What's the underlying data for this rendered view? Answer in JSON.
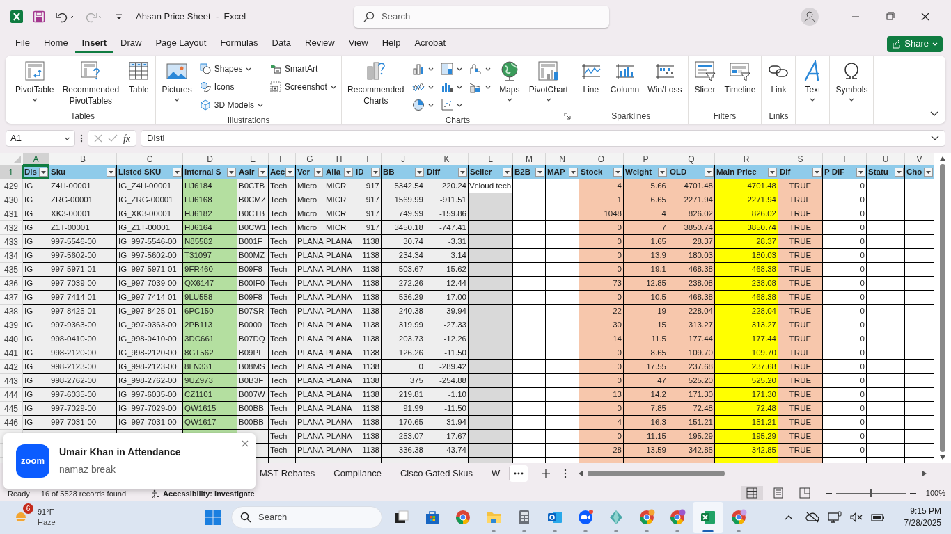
{
  "title_bar": {
    "title": "Ahsan Price Sheet  -  Excel",
    "search_placeholder": "Search"
  },
  "menu_tabs": [
    {
      "label": "File",
      "selected": false
    },
    {
      "label": "Home",
      "selected": false
    },
    {
      "label": "Insert",
      "selected": true
    },
    {
      "label": "Draw",
      "selected": false
    },
    {
      "label": "Page Layout",
      "selected": false
    },
    {
      "label": "Formulas",
      "selected": false
    },
    {
      "label": "Data",
      "selected": false
    },
    {
      "label": "Review",
      "selected": false
    },
    {
      "label": "View",
      "selected": false
    },
    {
      "label": "Help",
      "selected": false
    },
    {
      "label": "Acrobat",
      "selected": false
    }
  ],
  "share_button": "Share",
  "ribbon": {
    "groups": [
      {
        "label": "Tables",
        "items": [
          {
            "kind": "large",
            "label": "PivotTable",
            "dropdown": true
          },
          {
            "kind": "large",
            "label": "Recommended PivotTables",
            "dropdown": false
          },
          {
            "kind": "large",
            "label": "Table",
            "dropdown": false
          }
        ]
      },
      {
        "label": "Illustrations",
        "items": [
          {
            "kind": "large",
            "label": "Pictures",
            "dropdown": true
          },
          {
            "kind": "small",
            "label": "Shapes",
            "dropdown": true
          },
          {
            "kind": "small",
            "label": "Icons",
            "dropdown": false
          },
          {
            "kind": "small",
            "label": "3D Models",
            "dropdown": true
          },
          {
            "kind": "small",
            "label": "SmartArt",
            "dropdown": false
          },
          {
            "kind": "small",
            "label": "Screenshot",
            "dropdown": true
          }
        ]
      },
      {
        "label": "Charts",
        "launcher": true,
        "items": [
          {
            "kind": "large",
            "label": "Recommended Charts",
            "dropdown": false
          },
          {
            "kind": "icon",
            "dropdown": true
          },
          {
            "kind": "icon",
            "dropdown": true
          },
          {
            "kind": "icon",
            "dropdown": true
          },
          {
            "kind": "icon",
            "dropdown": true
          },
          {
            "kind": "icon",
            "dropdown": true
          },
          {
            "kind": "icon",
            "dropdown": true
          },
          {
            "kind": "icon",
            "dropdown": true
          },
          {
            "kind": "icon",
            "dropdown": true
          },
          {
            "kind": "large",
            "label": "Maps",
            "dropdown": true
          },
          {
            "kind": "large",
            "label": "PivotChart",
            "dropdown": true
          }
        ]
      },
      {
        "label": "Sparklines",
        "items": [
          {
            "kind": "large",
            "label": "Line",
            "dropdown": false
          },
          {
            "kind": "large",
            "label": "Column",
            "dropdown": false
          },
          {
            "kind": "large",
            "label": "Win/Loss",
            "dropdown": false
          }
        ]
      },
      {
        "label": "Filters",
        "items": [
          {
            "kind": "large",
            "label": "Slicer",
            "dropdown": false
          },
          {
            "kind": "large",
            "label": "Timeline",
            "dropdown": false
          }
        ]
      },
      {
        "label": "Links",
        "items": [
          {
            "kind": "large",
            "label": "Link",
            "dropdown": false
          }
        ]
      },
      {
        "items": [
          {
            "kind": "large",
            "label": "Text",
            "dropdown": true
          }
        ]
      },
      {
        "items": [
          {
            "kind": "large",
            "label": "Symbols",
            "dropdown": true
          }
        ]
      }
    ]
  },
  "formula_bar": {
    "name_box": "A1",
    "function_label": "fx",
    "formula": "Disti"
  },
  "sheet": {
    "header_row_number": "1",
    "columns": [
      {
        "letter": "A",
        "title": "Dis",
        "selected": true
      },
      {
        "letter": "B",
        "title": "Sku",
        "selected": false
      },
      {
        "letter": "C",
        "title": "Listed SKU",
        "selected": false
      },
      {
        "letter": "D",
        "title": "Internal S",
        "selected": false
      },
      {
        "letter": "E",
        "title": "Asir",
        "selected": false
      },
      {
        "letter": "F",
        "title": "Acc",
        "selected": false
      },
      {
        "letter": "G",
        "title": "Ver",
        "selected": false
      },
      {
        "letter": "H",
        "title": "Alia",
        "selected": false
      },
      {
        "letter": "I",
        "title": "ID",
        "selected": false
      },
      {
        "letter": "J",
        "title": "BB",
        "selected": false
      },
      {
        "letter": "K",
        "title": "Diff",
        "selected": false
      },
      {
        "letter": "L",
        "title": "Seller",
        "selected": false
      },
      {
        "letter": "M",
        "title": "B2B",
        "selected": false
      },
      {
        "letter": "N",
        "title": "MAP",
        "selected": false
      },
      {
        "letter": "O",
        "title": "Stock",
        "selected": false
      },
      {
        "letter": "P",
        "title": "Weight",
        "selected": false
      },
      {
        "letter": "Q",
        "title": "OLD",
        "selected": false
      },
      {
        "letter": "R",
        "title": "Main Price",
        "selected": false
      },
      {
        "letter": "S",
        "title": "Dif",
        "selected": false
      },
      {
        "letter": "T",
        "title": "P DIF",
        "selected": false
      },
      {
        "letter": "U",
        "title": "Statu",
        "selected": false
      },
      {
        "letter": "V",
        "title": "Cho",
        "selected": false
      }
    ],
    "rows": [
      {
        "number": "429",
        "cells": [
          "IG",
          "Z4H-00001",
          "IG_Z4H-00001",
          "HJ6184",
          "B0CTB",
          "Tech",
          "Micro",
          "MICR",
          "917",
          "5342.54",
          "220.24",
          "Vcloud tech",
          null,
          null,
          "4",
          "5.66",
          "4701.48",
          "4701.48",
          "TRUE",
          "0",
          null,
          null
        ]
      },
      {
        "number": "430",
        "cells": [
          "IG",
          "ZRG-00001",
          "IG_ZRG-00001",
          "HJ6168",
          "B0CMZ",
          "Tech",
          "Micro",
          "MICR",
          "917",
          "1569.99",
          "-911.51",
          null,
          null,
          null,
          "1",
          "6.65",
          "2271.94",
          "2271.94",
          "TRUE",
          "0",
          null,
          null
        ]
      },
      {
        "number": "431",
        "cells": [
          "IG",
          "XK3-00001",
          "IG_XK3-00001",
          "HJ6182",
          "B0CTB",
          "Tech",
          "Micro",
          "MICR",
          "917",
          "749.99",
          "-159.86",
          null,
          null,
          null,
          "1048",
          "4",
          "826.02",
          "826.02",
          "TRUE",
          "0",
          null,
          null
        ]
      },
      {
        "number": "432",
        "cells": [
          "IG",
          "Z1T-00001",
          "IG_Z1T-00001",
          "HJ6164",
          "B0CW1",
          "Tech",
          "Micro",
          "MICR",
          "917",
          "3450.18",
          "-747.41",
          null,
          null,
          null,
          "0",
          "7",
          "3850.74",
          "3850.74",
          "TRUE",
          "0",
          null,
          null
        ]
      },
      {
        "number": "433",
        "cells": [
          "IG",
          "997-5546-00",
          "IG_997-5546-00",
          "N85582",
          "B001F",
          "Tech",
          "PLANA",
          "PLANA",
          "1138",
          "30.74",
          "-3.31",
          null,
          null,
          null,
          "0",
          "1.65",
          "28.37",
          "28.37",
          "TRUE",
          "0",
          null,
          null
        ]
      },
      {
        "number": "434",
        "cells": [
          "IG",
          "997-5602-00",
          "IG_997-5602-00",
          "T31097",
          "B00MZ",
          "Tech",
          "PLANA",
          "PLANA",
          "1138",
          "234.34",
          "3.14",
          null,
          null,
          null,
          "0",
          "13.9",
          "180.03",
          "180.03",
          "TRUE",
          "0",
          null,
          null
        ]
      },
      {
        "number": "435",
        "cells": [
          "IG",
          "997-5971-01",
          "IG_997-5971-01",
          "9FR460",
          "B09F8",
          "Tech",
          "PLANA",
          "PLANA",
          "1138",
          "503.67",
          "-15.62",
          null,
          null,
          null,
          "0",
          "19.1",
          "468.38",
          "468.38",
          "TRUE",
          "0",
          null,
          null
        ]
      },
      {
        "number": "436",
        "cells": [
          "IG",
          "997-7039-00",
          "IG_997-7039-00",
          "QX6147",
          "B00IF0",
          "Tech",
          "PLANA",
          "PLANA",
          "1138",
          "272.26",
          "-12.44",
          null,
          null,
          null,
          "73",
          "12.85",
          "238.08",
          "238.08",
          "TRUE",
          "0",
          null,
          null
        ]
      },
      {
        "number": "437",
        "cells": [
          "IG",
          "997-7414-01",
          "IG_997-7414-01",
          "9LU558",
          "B09F8",
          "Tech",
          "PLANA",
          "PLANA",
          "1138",
          "536.29",
          "17.00",
          null,
          null,
          null,
          "0",
          "10.5",
          "468.38",
          "468.38",
          "TRUE",
          "0",
          null,
          null
        ]
      },
      {
        "number": "438",
        "cells": [
          "IG",
          "997-8425-01",
          "IG_997-8425-01",
          "6PC150",
          "B07SR",
          "Tech",
          "PLANA",
          "PLANA",
          "1138",
          "240.38",
          "-39.94",
          null,
          null,
          null,
          "22",
          "19",
          "228.04",
          "228.04",
          "TRUE",
          "0",
          null,
          null
        ]
      },
      {
        "number": "439",
        "cells": [
          "IG",
          "997-9363-00",
          "IG_997-9363-00",
          "2PB113",
          "B0000",
          "Tech",
          "PLANA",
          "PLANA",
          "1138",
          "319.99",
          "-27.33",
          null,
          null,
          null,
          "30",
          "15",
          "313.27",
          "313.27",
          "TRUE",
          "0",
          null,
          null
        ]
      },
      {
        "number": "440",
        "cells": [
          "IG",
          "998-0410-00",
          "IG_998-0410-00",
          "3DC661",
          "B07DQ",
          "Tech",
          "PLANA",
          "PLANA",
          "1138",
          "203.73",
          "-12.26",
          null,
          null,
          null,
          "14",
          "11.5",
          "177.44",
          "177.44",
          "TRUE",
          "0",
          null,
          null
        ]
      },
      {
        "number": "441",
        "cells": [
          "IG",
          "998-2120-00",
          "IG_998-2120-00",
          "8GT562",
          "B09PF",
          "Tech",
          "PLANA",
          "PLANA",
          "1138",
          "126.26",
          "-11.50",
          null,
          null,
          null,
          "0",
          "8.65",
          "109.70",
          "109.70",
          "TRUE",
          "0",
          null,
          null
        ]
      },
      {
        "number": "442",
        "cells": [
          "IG",
          "998-2123-00",
          "IG_998-2123-00",
          "8LN331",
          "B08MS",
          "Tech",
          "PLANA",
          "PLANA",
          "1138",
          "0",
          "-289.42",
          null,
          null,
          null,
          "0",
          "17.55",
          "237.68",
          "237.68",
          "TRUE",
          "0",
          null,
          null
        ]
      },
      {
        "number": "443",
        "cells": [
          "IG",
          "998-2762-00",
          "IG_998-2762-00",
          "9UZ973",
          "B0B3F",
          "Tech",
          "PLANA",
          "PLANA",
          "1138",
          "375",
          "-254.88",
          null,
          null,
          null,
          "0",
          "47",
          "525.20",
          "525.20",
          "TRUE",
          "0",
          null,
          null
        ]
      },
      {
        "number": "444",
        "cells": [
          "IG",
          "997-6035-00",
          "IG_997-6035-00",
          "CZ1101",
          "B007W",
          "Tech",
          "PLANA",
          "PLANA",
          "1138",
          "219.81",
          "-1.10",
          null,
          null,
          null,
          "13",
          "14.2",
          "171.30",
          "171.30",
          "TRUE",
          "0",
          null,
          null
        ]
      },
      {
        "number": "445",
        "cells": [
          "IG",
          "997-7029-00",
          "IG_997-7029-00",
          "QW1615",
          "B00BB",
          "Tech",
          "PLANA",
          "PLANA",
          "1138",
          "91.99",
          "-11.50",
          null,
          null,
          null,
          "0",
          "7.85",
          "72.48",
          "72.48",
          "TRUE",
          "0",
          null,
          null
        ]
      },
      {
        "number": "446",
        "cells": [
          "IG",
          "997-7031-00",
          "IG_997-7031-00",
          "QW1617",
          "B00BB",
          "Tech",
          "PLANA",
          "PLANA",
          "1138",
          "170.65",
          "-31.94",
          null,
          null,
          null,
          "4",
          "16.3",
          "151.21",
          "151.21",
          "TRUE",
          "0",
          null,
          null
        ]
      },
      {
        "number": null,
        "cells": [
          null,
          null,
          null,
          null,
          null,
          "Tech",
          "PLANA",
          "PLANA",
          "1138",
          "253.07",
          "17.67",
          null,
          null,
          null,
          "0",
          "11.15",
          "195.29",
          "195.29",
          "TRUE",
          "0",
          null,
          null
        ]
      },
      {
        "number": null,
        "cells": [
          null,
          null,
          null,
          null,
          null,
          "Tech",
          "PLANA",
          "PLANA",
          "1138",
          "336.38",
          "-43.74",
          null,
          null,
          null,
          "28",
          "13.59",
          "342.85",
          "342.85",
          "TRUE",
          "0",
          null,
          null
        ]
      },
      {
        "number": null,
        "cells": [
          null,
          null,
          null,
          null,
          null,
          null,
          null,
          null,
          null,
          null,
          null,
          null,
          null,
          null,
          null,
          null,
          null,
          null,
          null,
          null,
          null,
          null
        ]
      }
    ]
  },
  "sheet_tabs": [
    {
      "label": "MST Rebates",
      "selected": false
    },
    {
      "label": "Compliance",
      "selected": false
    },
    {
      "label": "Cisco Gated Skus",
      "selected": false
    },
    {
      "label": "W",
      "selected": false
    }
  ],
  "status_bar": {
    "mode": "Ready",
    "records": "16 of 5528 records found",
    "accessibility": "Accessibility: Investigate",
    "views": [
      {
        "selected": true
      },
      {
        "selected": false
      },
      {
        "selected": false
      }
    ],
    "zoom": {
      "level": 0.5,
      "reading": "100%"
    }
  },
  "notification": {
    "app_icon_text": "zoom",
    "title": "Umair Khan in Attendance",
    "message": "namaz break"
  },
  "taskbar": {
    "weather": {
      "badge": "6",
      "temperature": "91°F",
      "condition": "Haze"
    },
    "search_placeholder": "Search",
    "apps": [
      {
        "running": false,
        "active": false
      },
      {
        "running": false,
        "active": false
      },
      {
        "running": false,
        "active": false
      },
      {
        "running": true,
        "active": false
      },
      {
        "running": true,
        "active": false
      },
      {
        "running": true,
        "active": false
      },
      {
        "running": true,
        "active": false
      },
      {
        "running": true,
        "active": false
      },
      {
        "running": true,
        "active": false
      },
      {
        "running": true,
        "active": false
      },
      {
        "running": true,
        "active": true
      },
      {
        "running": true,
        "active": false
      }
    ],
    "time": "9:15 PM",
    "date": "7/28/2025"
  }
}
